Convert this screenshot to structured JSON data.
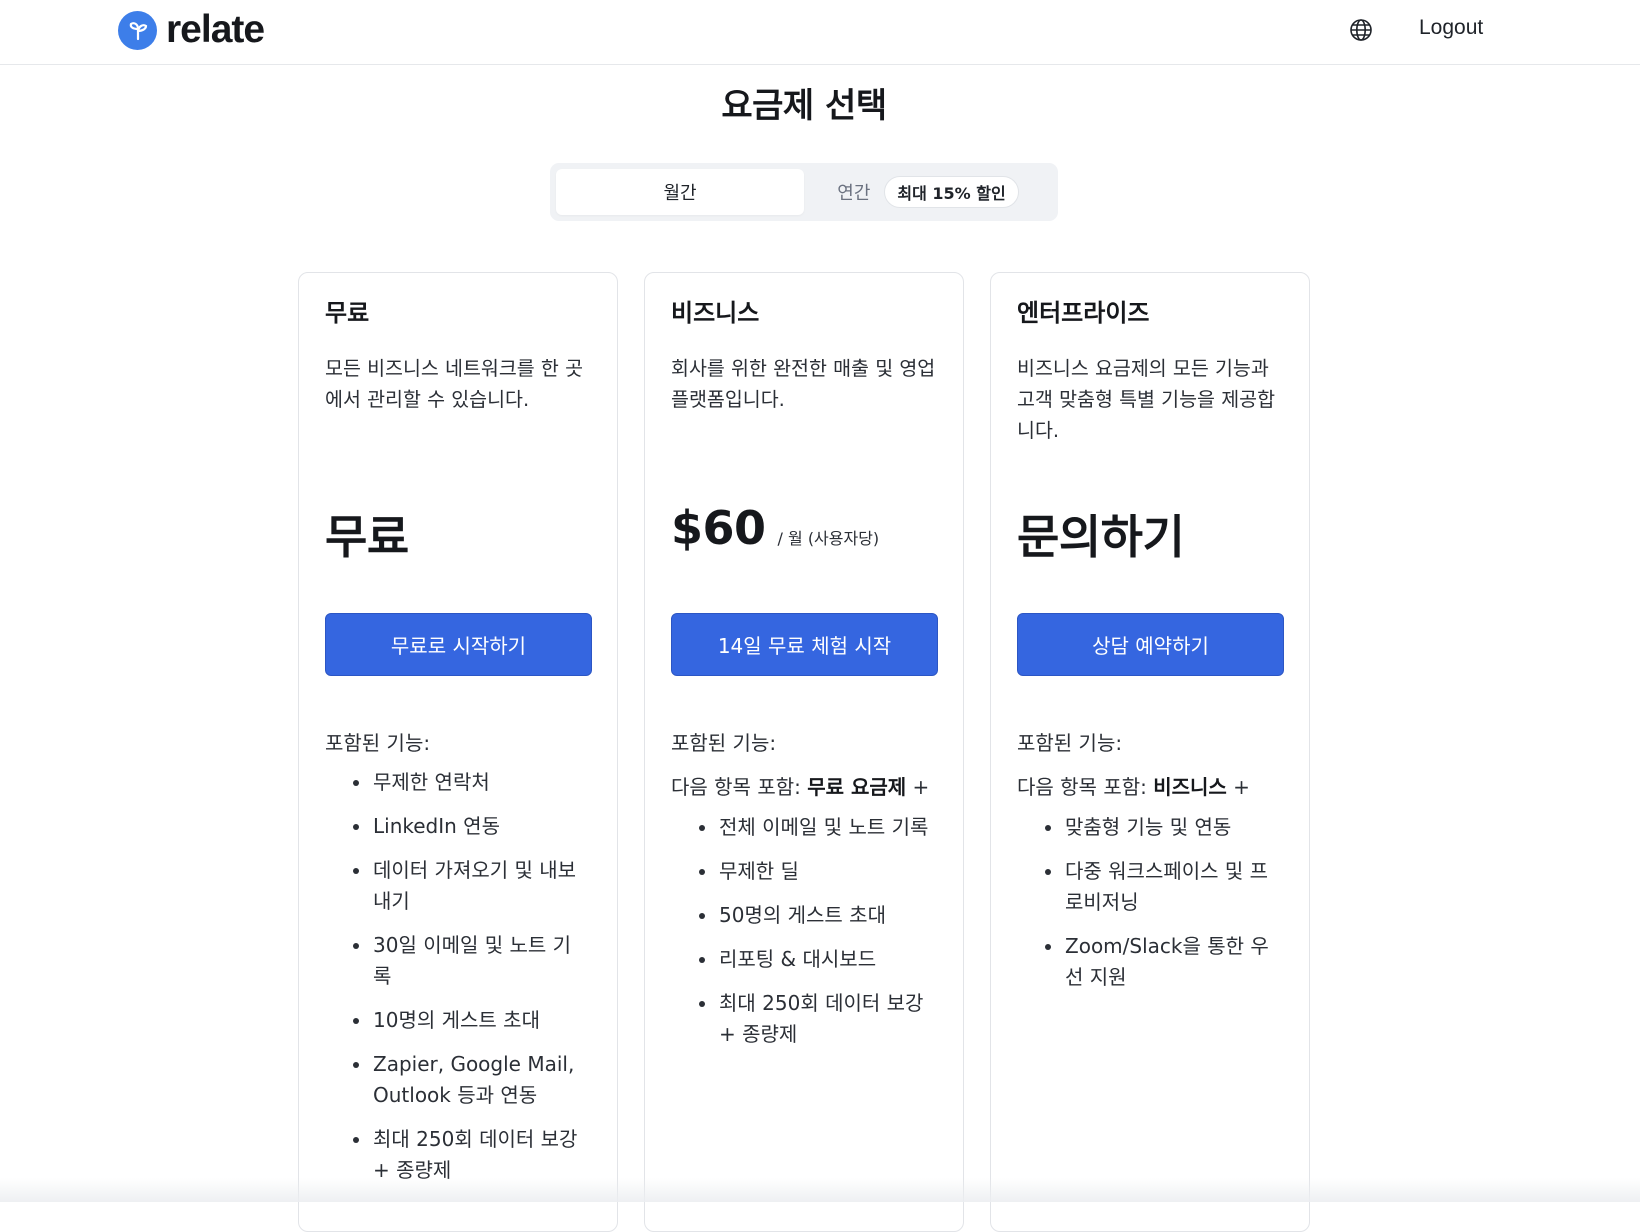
{
  "brand": {
    "name": "relate",
    "accent": "#3d7ee9"
  },
  "header": {
    "globe_icon": "globe-icon",
    "logout_label": "Logout"
  },
  "page": {
    "title": "요금제 선택"
  },
  "billing_toggle": {
    "monthly_label": "월간",
    "yearly_label": "연간",
    "discount_badge": "최대 15% 할인",
    "selected": "월간"
  },
  "plans": [
    {
      "name": "무료",
      "description": "모든 비즈니스 네트워크를 한 곳에서 관리할 수 있습니다.",
      "price": "무료",
      "price_unit": "",
      "cta_label": "무료로 시작하기",
      "features_title": "포함된 기능:",
      "includes_prefix": "",
      "includes_plan": "",
      "includes_suffix": "",
      "features": [
        "무제한 연락처",
        "LinkedIn 연동",
        "데이터 가져오기 및 내보내기",
        "30일 이메일 및 노트 기록",
        "10명의 게스트 초대",
        "Zapier, Google Mail, Outlook 등과 연동",
        "최대 250회 데이터 보강 + 종량제"
      ]
    },
    {
      "name": "비즈니스",
      "description": "회사를 위한 완전한 매출 및 영업 플랫폼입니다.",
      "price": "$60",
      "price_unit": "/ 월 (사용자당)",
      "cta_label": "14일 무료 체험 시작",
      "features_title": "포함된 기능:",
      "includes_prefix": "다음 항목 포함: ",
      "includes_plan": "무료 요금제",
      "includes_suffix": " +",
      "features": [
        "전체 이메일 및 노트 기록",
        "무제한 딜",
        "50명의 게스트 초대",
        "리포팅 & 대시보드",
        "최대 250회 데이터 보강 + 종량제"
      ]
    },
    {
      "name": "엔터프라이즈",
      "description": "비즈니스 요금제의 모든 기능과 고객 맞춤형 특별 기능을 제공합니다.",
      "price": "문의하기",
      "price_unit": "",
      "cta_label": "상담 예약하기",
      "features_title": "포함된 기능:",
      "includes_prefix": "다음 항목 포함: ",
      "includes_plan": "비즈니스",
      "includes_suffix": " +",
      "features": [
        "맞춤형 기능 및 연동",
        "다중 워크스페이스 및 프로비저닝",
        "Zoom/Slack을 통한 우선 지원"
      ]
    }
  ],
  "colors": {
    "primary_button": "#3566e0",
    "toggle_bg": "#f0f2f5",
    "border": "#e2e4e8"
  }
}
